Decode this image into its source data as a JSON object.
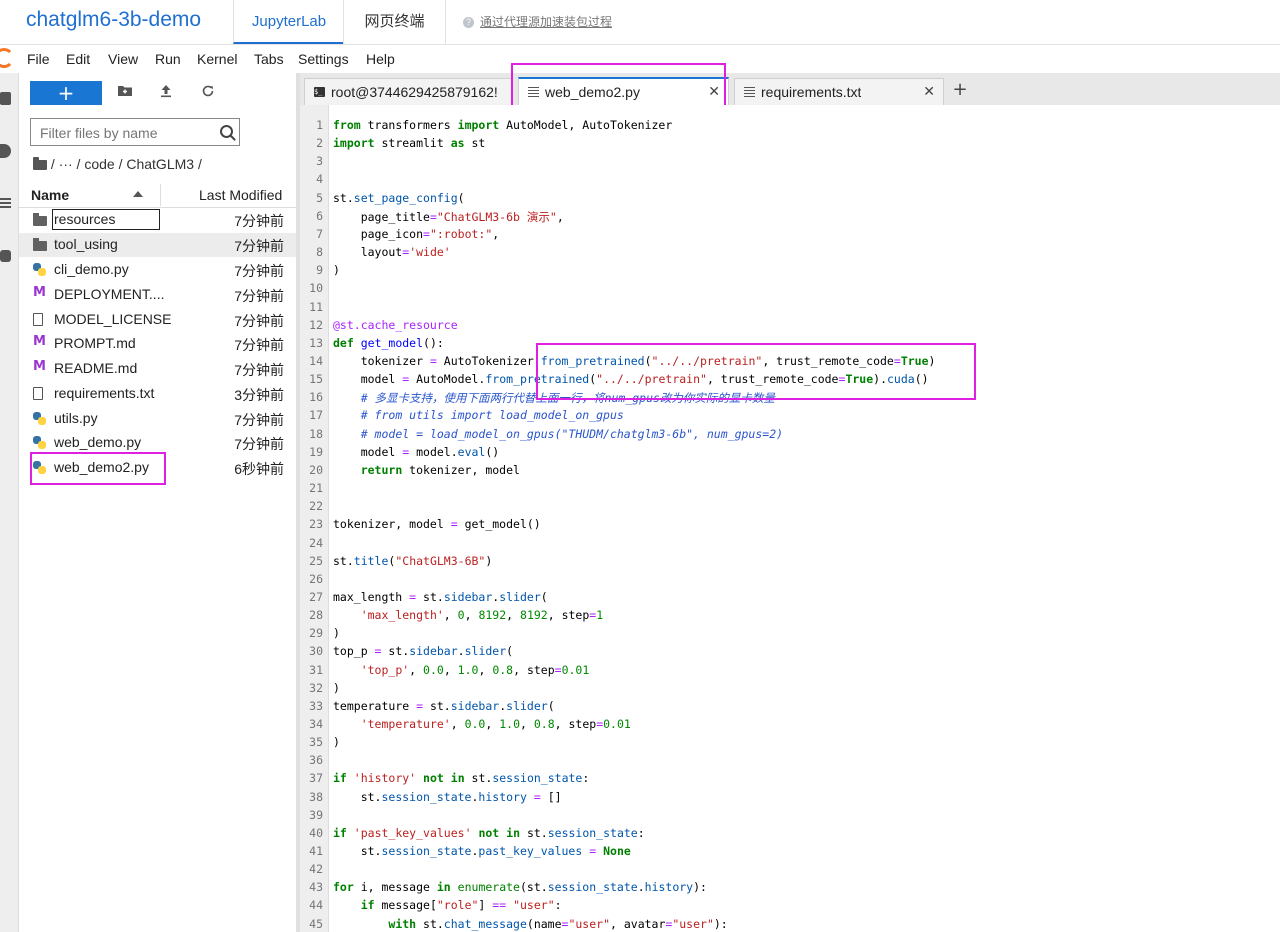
{
  "header": {
    "app_title": "chatglm6-3b-demo",
    "tabs": [
      "JupyterLab",
      "网页终端"
    ],
    "proxy_link": "通过代理源加速装包过程"
  },
  "menu": [
    "File",
    "Edit",
    "View",
    "Run",
    "Kernel",
    "Tabs",
    "Settings",
    "Help"
  ],
  "filebrowser": {
    "new_label": "+",
    "search_placeholder": "Filter files by name",
    "breadcrumb": "/  ···  / code / ChatGLM3 /",
    "col_name": "Name",
    "col_modified": "Last Modified",
    "files": [
      {
        "name": "resources",
        "time": "7分钟前",
        "type": "folder"
      },
      {
        "name": "tool_using",
        "time": "7分钟前",
        "type": "folder"
      },
      {
        "name": "cli_demo.py",
        "time": "7分钟前",
        "type": "python"
      },
      {
        "name": "DEPLOYMENT....",
        "time": "7分钟前",
        "type": "markdown"
      },
      {
        "name": "MODEL_LICENSE",
        "time": "7分钟前",
        "type": "text"
      },
      {
        "name": "PROMPT.md",
        "time": "7分钟前",
        "type": "markdown"
      },
      {
        "name": "README.md",
        "time": "7分钟前",
        "type": "markdown"
      },
      {
        "name": "requirements.txt",
        "time": "3分钟前",
        "type": "text"
      },
      {
        "name": "utils.py",
        "time": "7分钟前",
        "type": "python"
      },
      {
        "name": "web_demo.py",
        "time": "7分钟前",
        "type": "python"
      },
      {
        "name": "web_demo2.py",
        "time": "6秒钟前",
        "type": "python"
      }
    ]
  },
  "doc_tabs": [
    {
      "label": "root@3744629425879162!",
      "icon": "terminal-icon"
    },
    {
      "label": "web_demo2.py",
      "icon": "text-file-icon",
      "active": true
    },
    {
      "label": "requirements.txt",
      "icon": "text-file-icon"
    }
  ],
  "editor": {
    "line_numbers": [
      "1",
      "2",
      "3",
      "4",
      "5",
      "6",
      "7",
      "8",
      "9",
      "10",
      "11",
      "12",
      "13",
      "14",
      "15",
      "16",
      "17",
      "18",
      "19",
      "20",
      "21",
      "22",
      "23",
      "24",
      "25",
      "26",
      "27",
      "28",
      "29",
      "30",
      "31",
      "32",
      "33",
      "34",
      "35",
      "36",
      "37",
      "38",
      "39",
      "40",
      "41",
      "42",
      "43",
      "44",
      "45"
    ],
    "code_lines": [
      "from transformers import AutoModel, AutoTokenizer",
      "import streamlit as st",
      "",
      "",
      "st.set_page_config(",
      "    page_title=\"ChatGLM3-6b 演示\",",
      "    page_icon=\":robot:\",",
      "    layout='wide'",
      ")",
      "",
      "",
      "@st.cache_resource",
      "def get_model():",
      "    tokenizer = AutoTokenizer.from_pretrained(\"../../pretrain\", trust_remote_code=True)",
      "    model = AutoModel.from_pretrained(\"../../pretrain\", trust_remote_code=True).cuda()",
      "    # 多显卡支持，使用下面两行代替上面一行，将num_gpus改为你实际的显卡数量",
      "    # from utils import load_model_on_gpus",
      "    # model = load_model_on_gpus(\"THUDM/chatglm3-6b\", num_gpus=2)",
      "    model = model.eval()",
      "    return tokenizer, model",
      "",
      "",
      "tokenizer, model = get_model()",
      "",
      "st.title(\"ChatGLM3-6B\")",
      "",
      "max_length = st.sidebar.slider(",
      "    'max_length', 0, 8192, 8192, step=1",
      ")",
      "top_p = st.sidebar.slider(",
      "    'top_p', 0.0, 1.0, 0.8, step=0.01",
      ")",
      "temperature = st.sidebar.slider(",
      "    'temperature', 0.0, 1.0, 0.8, step=0.01",
      ")",
      "",
      "if 'history' not in st.session_state:",
      "    st.session_state.history = []",
      "",
      "if 'past_key_values' not in st.session_state:",
      "    st.session_state.past_key_values = None",
      "",
      "for i, message in enumerate(st.session_state.history):",
      "    if message[\"role\"] == \"user\":",
      "        with st.chat_message(name=\"user\", avatar=\"user\"):"
    ]
  },
  "colors": {
    "accent": "#1976d2",
    "title_blue": "#1f6fd1",
    "annotation": "#e020e0"
  }
}
